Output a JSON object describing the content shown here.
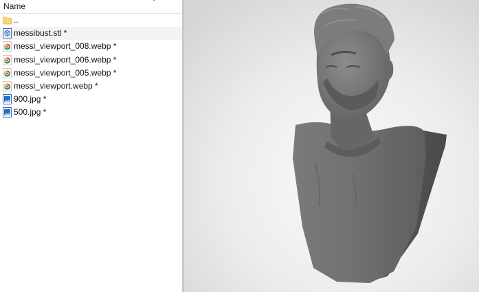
{
  "explorer": {
    "column_header": "Name",
    "files": [
      {
        "name": "..",
        "icon": "folder-icon",
        "selected": false
      },
      {
        "name": "messibust.stl *",
        "icon": "stl-file-icon",
        "selected": true
      },
      {
        "name": "messi_viewport_008.webp *",
        "icon": "chrome-file-icon",
        "selected": false
      },
      {
        "name": "messi_viewport_006.webp *",
        "icon": "chrome-file-icon",
        "selected": false
      },
      {
        "name": "messi_viewport_005.webp *",
        "icon": "chrome-file-icon",
        "selected": false
      },
      {
        "name": "messi_viewport.webp *",
        "icon": "chrome-file-icon",
        "selected": false
      },
      {
        "name": "900.jpg *",
        "icon": "image-file-icon",
        "selected": false
      },
      {
        "name": "500.jpg *",
        "icon": "image-file-icon",
        "selected": false
      }
    ]
  },
  "viewport": {
    "model": "3d-bust-model",
    "colors": {
      "background_light": "#f5f5f5",
      "background_mid": "#dedede",
      "model_base": "#6e6e6e",
      "model_shadow": "#4f4f4f",
      "model_highlight": "#8c8c8c"
    }
  }
}
